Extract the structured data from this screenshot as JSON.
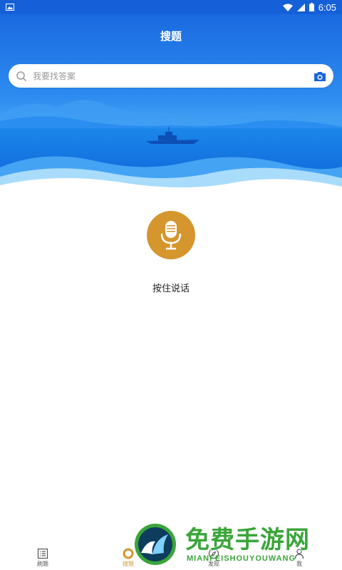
{
  "status_bar": {
    "time": "6:05",
    "icons": [
      "image-icon",
      "wifi-icon",
      "signal-icon",
      "battery-icon"
    ]
  },
  "header": {
    "title": "搜题"
  },
  "search": {
    "placeholder": "我要找答案",
    "icon": "search-icon",
    "camera_icon": "camera-icon"
  },
  "voice": {
    "label": "按住说话",
    "icon": "microphone-icon",
    "color": "#d6962e"
  },
  "bottom_nav": {
    "items": [
      {
        "label": "刷题",
        "icon": "list-icon",
        "active": false
      },
      {
        "label": "搜题",
        "icon": "search-circle-icon",
        "active": true
      },
      {
        "label": "发现",
        "icon": "compass-icon",
        "active": false
      },
      {
        "label": "我",
        "icon": "person-icon",
        "active": false
      }
    ]
  },
  "watermark": {
    "text": "免费手游网",
    "subtext": "MIANFEISHOUYOUWANG"
  },
  "colors": {
    "primary_blue": "#1560d8",
    "accent_orange": "#d6962e",
    "watermark_green": "#3aa53a"
  }
}
